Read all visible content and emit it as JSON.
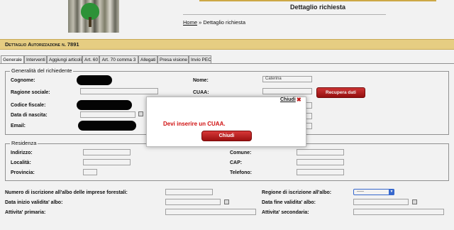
{
  "header": {
    "page_title": "Dettaglio richiesta",
    "breadcrumb": {
      "home": "Home",
      "separator": "»",
      "current": "Dettaglio richiesta"
    }
  },
  "title_bar": {
    "prefix": "Dettaglio Autorizzazione n.",
    "number": "7891"
  },
  "tabs": [
    {
      "label": "Generale",
      "active": true
    },
    {
      "label": "Interventi"
    },
    {
      "label": "Aggiungi articoli"
    },
    {
      "label": "Art. 60"
    },
    {
      "label": "Art. 70 comma 3"
    },
    {
      "label": "Allegati"
    },
    {
      "label": "Presa visione"
    },
    {
      "label": "Invio PEC"
    }
  ],
  "richiedente": {
    "legend": "Generalità del richiedente",
    "cognome_label": "Cognome:",
    "ragione_label": "Ragione sociale:",
    "codice_label": "Codice fiscale:",
    "nascita_label": "Data di nascita:",
    "email_label": "Email:",
    "nome_label": "Nome:",
    "nome_value": "Caterina",
    "cuaa_label": "CUAA:",
    "recupera_label": "Recupera dati"
  },
  "residenza": {
    "legend": "Residenza",
    "indirizzo_label": "Indirizzo:",
    "localita_label": "Località:",
    "provincia_label": "Provincia:",
    "comune_label": "Comune:",
    "cap_label": "CAP:",
    "telefono_label": "Telefono:"
  },
  "albo": {
    "numero_label": "Numero di iscrizione all'albo delle imprese forestali:",
    "inizio_label": "Data inizio validita' albo:",
    "attivita_primaria_label": "Attivita' primaria:",
    "regione_label": "Regione di iscrizione all'albo:",
    "regione_value": "-----",
    "fine_label": "Data fine validita' albo:",
    "attivita_secondaria_label": "Attivita' secondaria:"
  },
  "modal": {
    "close_link": "Chiudi",
    "close_glyph": "✖",
    "message": "Devi inserire un CUAA.",
    "button": "Chiudi"
  },
  "colors": {
    "title_bar": "#f3d989",
    "accent_red": "#c01818",
    "select_blue": "#3a6ed8"
  }
}
